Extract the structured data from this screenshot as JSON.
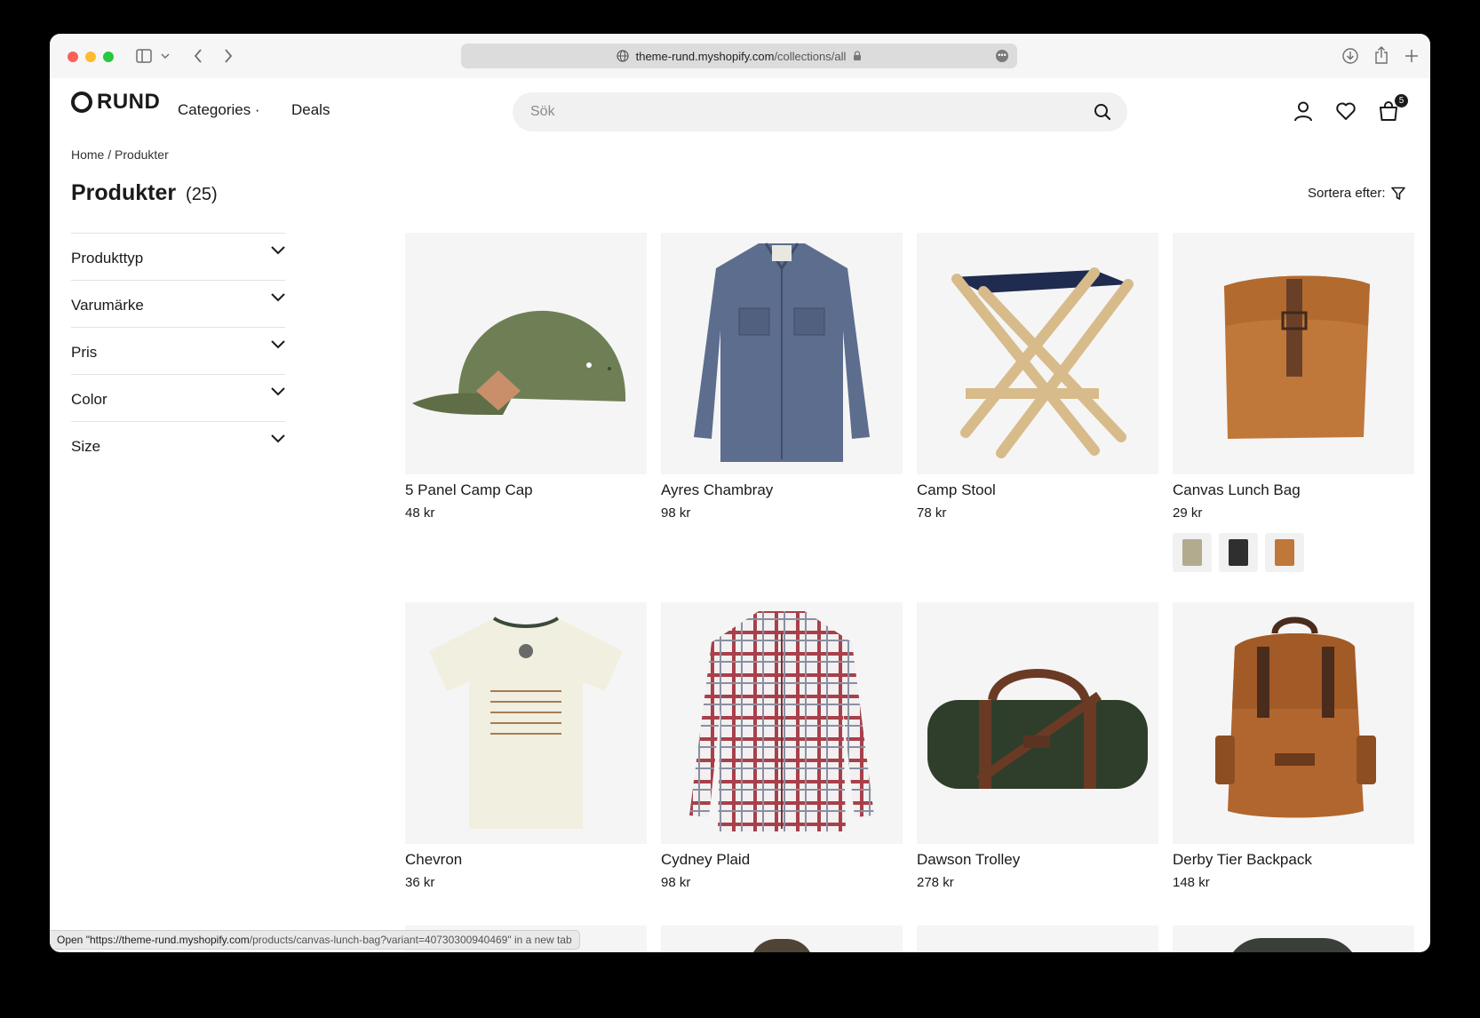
{
  "browser": {
    "url_host": "theme-rund.myshopify.com",
    "url_path": "/collections/all"
  },
  "header": {
    "logo_text": "RUND",
    "nav": [
      {
        "label": "Categories ·"
      },
      {
        "label": "Deals"
      }
    ],
    "search_placeholder": "Sök",
    "cart_count": "5"
  },
  "breadcrumb": {
    "home": "Home",
    "separator": "/",
    "current": "Produkter"
  },
  "page": {
    "title": "Produkter",
    "count": "(25)",
    "sort_label": "Sortera efter:"
  },
  "filters": [
    {
      "label": "Produkttyp"
    },
    {
      "label": "Varumärke"
    },
    {
      "label": "Pris"
    },
    {
      "label": "Color"
    },
    {
      "label": "Size"
    }
  ],
  "products": [
    {
      "name": "5 Panel Camp Cap",
      "price": "48 kr",
      "image": "green-cap"
    },
    {
      "name": "Ayres Chambray",
      "price": "98 kr",
      "image": "blue-shirt"
    },
    {
      "name": "Camp Stool",
      "price": "78 kr",
      "image": "wood-stool"
    },
    {
      "name": "Canvas Lunch Bag",
      "price": "29 kr",
      "image": "tan-bag",
      "swatches": [
        "khaki",
        "black",
        "tan"
      ]
    },
    {
      "name": "Chevron",
      "price": "36 kr",
      "image": "cream-tshirt"
    },
    {
      "name": "Cydney Plaid",
      "price": "98 kr",
      "image": "plaid-shirt"
    },
    {
      "name": "Dawson Trolley",
      "price": "278 kr",
      "image": "green-duffel"
    },
    {
      "name": "Derby Tier Backpack",
      "price": "148 kr",
      "image": "brown-backpack"
    }
  ],
  "status_bar": {
    "text_host": "Open \"https://theme-rund.myshopify.com",
    "text_path": "/products/canvas-lunch-bag?variant=40730300940469\" in a new tab"
  },
  "colors": {
    "accent": "#1a1a1a",
    "image_bg": "#f5f5f5",
    "search_bg": "#f1f1f1"
  }
}
